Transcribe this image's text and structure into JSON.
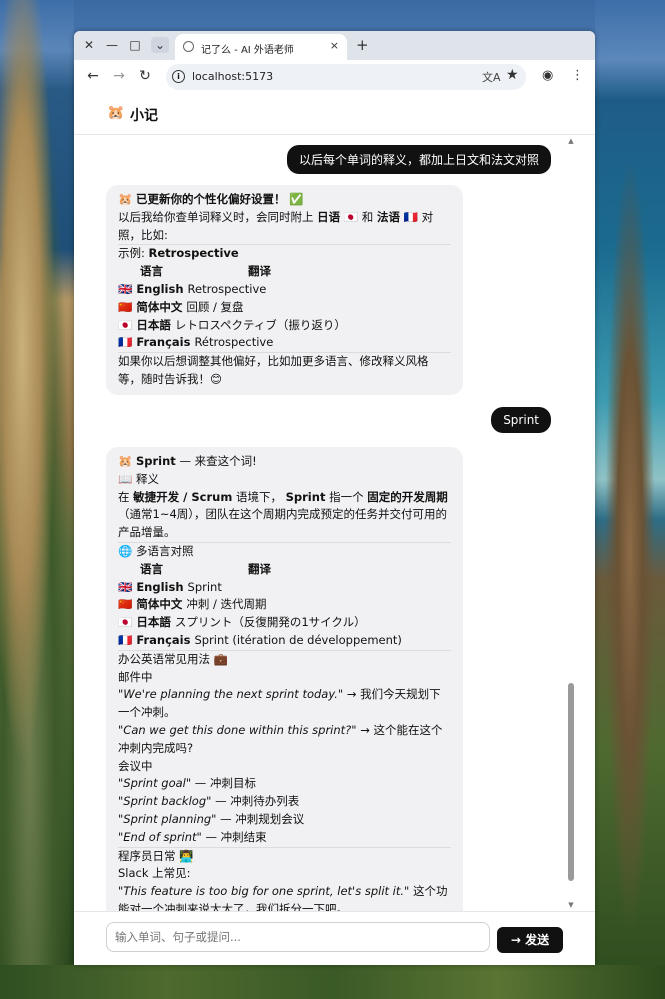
{
  "browser": {
    "tab_title": "记了么 - AI 外语老师",
    "tab_close": "×",
    "new_tab": "+",
    "window_close": "✕",
    "window_min": "—",
    "window_max": "□",
    "tab_search": "⌄",
    "back": "←",
    "forward": "→",
    "reload": "↻",
    "url": "localhost:5173",
    "translate_icon": "文A",
    "bookmark_icon": "★",
    "profile_icon": "◉",
    "menu_icon": "⋮"
  },
  "app": {
    "logo_emoji": "🐹",
    "name": "小记"
  },
  "messages": {
    "user1": "以后每个单词的释义，都加上日文和法文对照",
    "bot1": {
      "title_emoji": "🐹",
      "title": "已更新你的个性化偏好设置！",
      "title_check": "✅",
      "p1_a": "以后我给你查单词释义时，会同时附上",
      "p1_ja": "日语",
      "p1_ja_flag": "🇯🇵",
      "p1_and": "和",
      "p1_fr": "法语",
      "p1_fr_flag": "🇫🇷",
      "p1_b": "对照，比如:",
      "example_label": "示例:",
      "example_word": "Retrospective",
      "col_lang": "语言",
      "col_trans": "翻译",
      "rows": [
        {
          "flag": "🇬🇧",
          "lang": "English",
          "val": "Retrospective"
        },
        {
          "flag": "🇨🇳",
          "lang": "简体中文",
          "val": "回顾 / 复盘"
        },
        {
          "flag": "🇯🇵",
          "lang": "日本語",
          "val": "レトロスペクティブ（振り返り）"
        },
        {
          "flag": "🇫🇷",
          "lang": "Français",
          "val": "Rétrospective"
        }
      ],
      "footer": "如果你以后想调整其他偏好，比如加更多语言、修改释义风格等，随时告诉我！😊"
    },
    "user2": "Sprint",
    "bot2": {
      "title_emoji": "🐹",
      "title_word": "Sprint",
      "title_rest": "— 来查这个词!",
      "def_icon": "📖",
      "def_label": "释义",
      "def_a": "在",
      "def_ctx": "敏捷开发 / Scrum",
      "def_b": "语境下，",
      "def_word": "Sprint",
      "def_c": "指一个",
      "def_bold": "固定的开发周期",
      "def_d": "（通常1~4周），团队在这个周期内完成预定的任务并交付可用的产品增量。",
      "multi_icon": "🌐",
      "multi_label": "多语言对照",
      "col_lang": "语言",
      "col_trans": "翻译",
      "rows": [
        {
          "flag": "🇬🇧",
          "lang": "English",
          "val": "Sprint"
        },
        {
          "flag": "🇨🇳",
          "lang": "简体中文",
          "val": "冲刺 / 迭代周期"
        },
        {
          "flag": "🇯🇵",
          "lang": "日本語",
          "val": "スプリント（反復開発の1サイクル）"
        },
        {
          "flag": "🇫🇷",
          "lang": "Français",
          "val": "Sprint (itération de développement)"
        }
      ],
      "office_label": "办公英语常见用法 💼",
      "mail_label": "邮件中",
      "mail1_en": "\"We're planning the next sprint today.\"",
      "mail1_zh": "→ 我们今天规划下一个冲刺。",
      "mail2_en": "\"Can we get this done within this sprint?\"",
      "mail2_zh": "→ 这个能在这个冲刺内完成吗?",
      "meeting_label": "会议中",
      "meeting": [
        {
          "en": "\"Sprint goal\"",
          "zh": "— 冲刺目标"
        },
        {
          "en": "\"Sprint backlog\"",
          "zh": "— 冲刺待办列表"
        },
        {
          "en": "\"Sprint planning\"",
          "zh": "— 冲刺规划会议"
        },
        {
          "en": "\"End of sprint\"",
          "zh": "— 冲刺结束"
        }
      ],
      "dev_label": "程序员日常 👨‍💻",
      "slack_label": "Slack 上常见:",
      "slack_en": "\"This feature is too big for one sprint, let's split it.\"",
      "slack_zh": "这个功能对一个冲刺来说太大了，我们拆分一下吧。"
    }
  },
  "input": {
    "placeholder": "输入单词、句子或提问...",
    "send_label": "→ 发送"
  }
}
